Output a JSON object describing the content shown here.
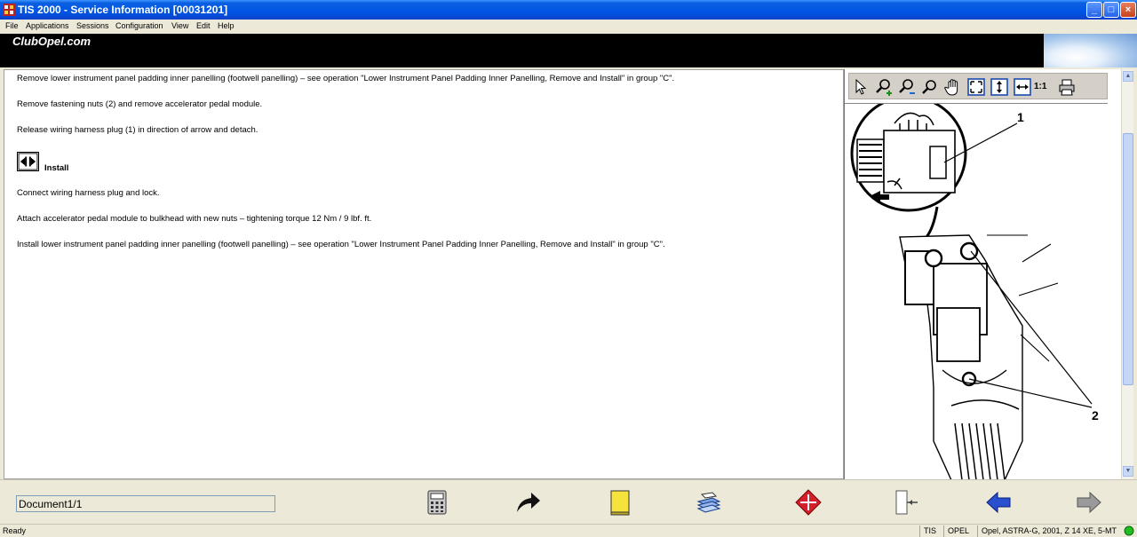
{
  "window": {
    "title": "TIS 2000 - Service Information [00031201]",
    "controls": {
      "minimize": "_",
      "maximize": "□",
      "close": "×"
    }
  },
  "menu": [
    "File",
    "Applications",
    "Sessions",
    "Configuration",
    "View",
    "Edit",
    "Help"
  ],
  "banner": {
    "logo": "ClubOpel.com"
  },
  "content": {
    "steps_remove": [
      "Remove lower instrument panel padding inner panelling (footwell panelling) – see operation \"Lower Instrument Panel Padding Inner Panelling, Remove and Install\" in group \"C\".",
      "Remove fastening nuts (2) and remove accelerator pedal module.",
      "Release wiring harness plug (1) in direction of arrow and detach."
    ],
    "install_label": "Install",
    "steps_install": [
      "Connect wiring harness plug and lock.",
      "Attach accelerator pedal module to bulkhead with new nuts – tightening torque 12 Nm / 9 lbf. ft.",
      "Install lower instrument panel padding inner panelling (footwell panelling) – see operation \"Lower Instrument Panel Padding Inner Panelling, Remove and Install\" in group \"C\"."
    ]
  },
  "viewer": {
    "toolbar": [
      {
        "icon": "pointer-icon"
      },
      {
        "icon": "zoom-in-icon"
      },
      {
        "icon": "zoom-out-icon"
      },
      {
        "icon": "zoom-icon"
      },
      {
        "icon": "pan-hand-icon"
      },
      {
        "icon": "fit-page-icon"
      },
      {
        "icon": "fit-height-icon"
      },
      {
        "icon": "fit-width-icon"
      },
      {
        "icon": "actual-size-icon",
        "label": "1:1"
      },
      {
        "icon": "print-icon"
      }
    ],
    "callouts": [
      "1",
      "2"
    ]
  },
  "bottombar": {
    "document_field": "Document1/1",
    "buttons": [
      {
        "icon": "calculator-icon"
      },
      {
        "icon": "forward-arrow-icon"
      },
      {
        "icon": "notepad-icon"
      },
      {
        "icon": "stack-pages-icon"
      },
      {
        "icon": "stop-diamond-icon"
      },
      {
        "icon": "exit-door-icon"
      },
      {
        "icon": "back-arrow-icon"
      },
      {
        "icon": "next-arrow-icon"
      }
    ]
  },
  "status": {
    "text": "Ready",
    "cells": [
      "TIS",
      "OPEL",
      "Opel, ASTRA-G, 2001, Z 14 XE, 5-MT"
    ],
    "indicator_color": "#22bb22"
  }
}
